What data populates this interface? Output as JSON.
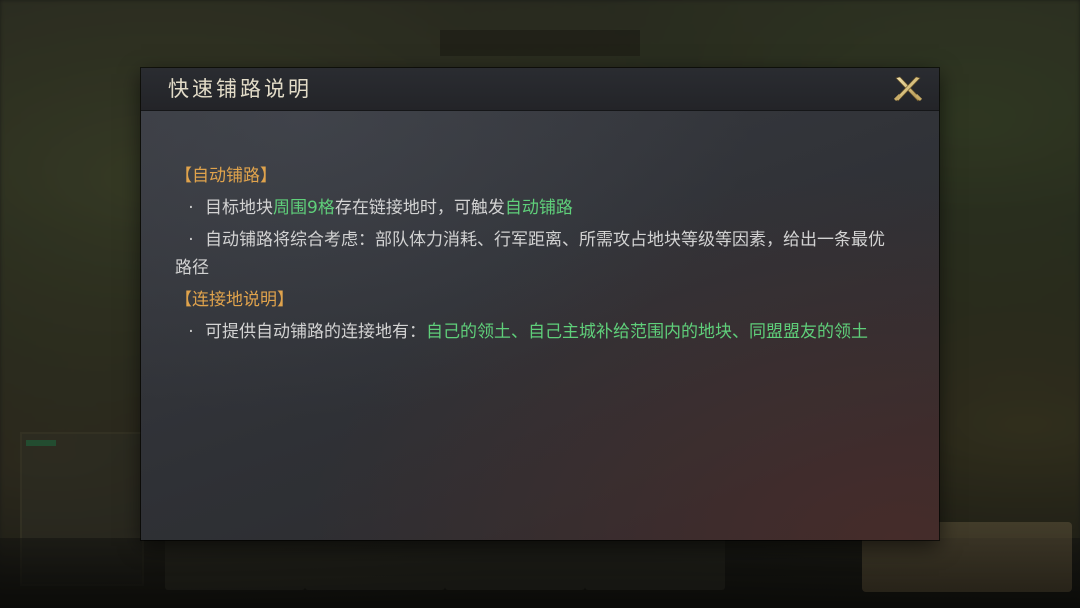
{
  "dialog": {
    "title": "快速铺路说明",
    "close_icon": "crossed-swords-close-icon"
  },
  "sections": [
    {
      "title": "【自动铺路】",
      "bullets": [
        {
          "dot": "·",
          "parts": [
            {
              "text": "目标地块",
              "color": "#d2d2d2"
            },
            {
              "text": "周围9格",
              "color": "#5fcf7a"
            },
            {
              "text": "存在链接地时，可触发",
              "color": "#d2d2d2"
            },
            {
              "text": "自动铺路",
              "color": "#5fcf7a"
            }
          ]
        },
        {
          "dot": "·",
          "parts": [
            {
              "text": "自动铺路将综合考虑：部队体力消耗、行军距离、所需攻占地块等级等因素，给出一条最优路径",
              "color": "#d2d2d2"
            }
          ]
        }
      ]
    },
    {
      "title": "【连接地说明】",
      "bullets": [
        {
          "dot": "·",
          "parts": [
            {
              "text": "可提供自动铺路的连接地有：",
              "color": "#d2d2d2"
            },
            {
              "text": "自己的领土、自己主城补给范围内的地块、同盟盟友的领土",
              "color": "#5fcf7a"
            }
          ]
        }
      ]
    }
  ],
  "colors": {
    "section_title": "#e0a34c",
    "highlight": "#5fcf7a",
    "body_text": "#d2d2d2"
  }
}
